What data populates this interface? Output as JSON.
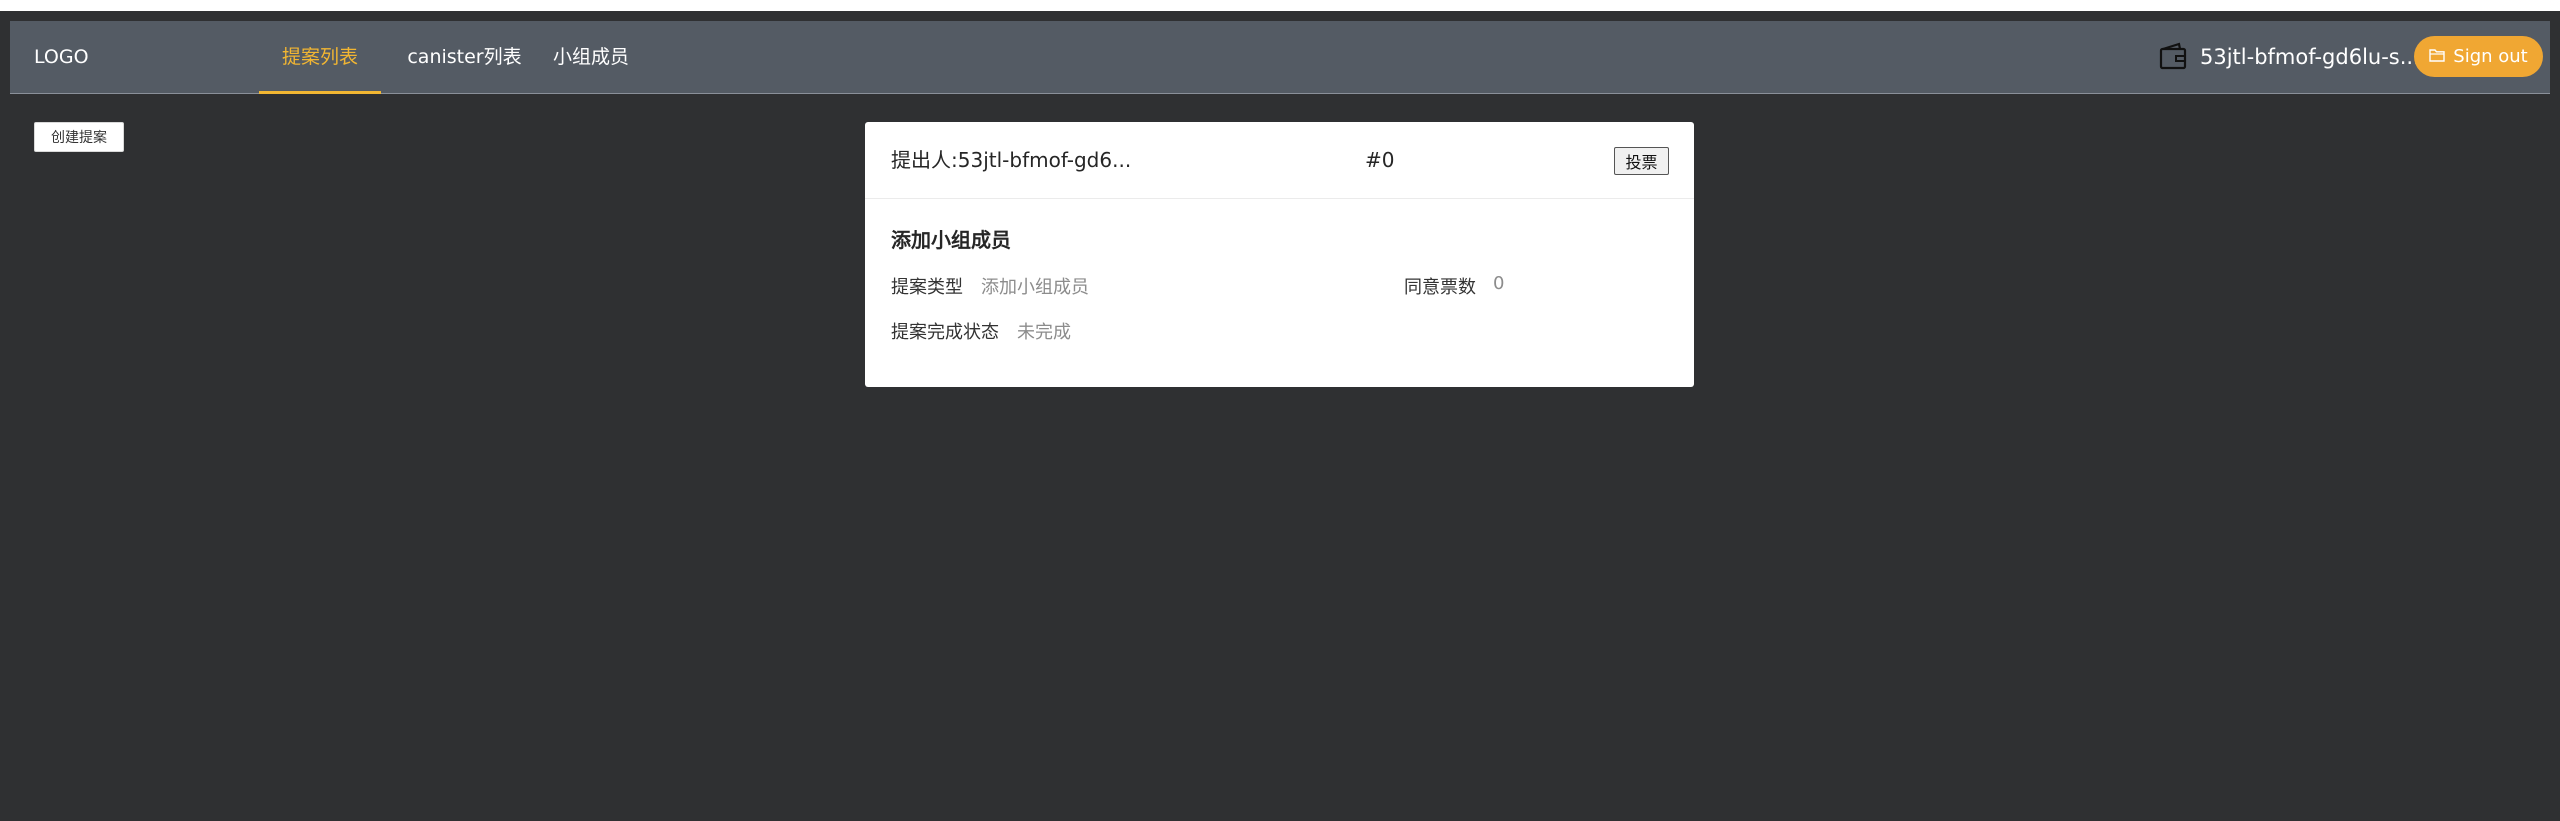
{
  "navbar": {
    "logo": "LOGO",
    "tabs": [
      {
        "label": "提案列表",
        "active": true
      },
      {
        "label": "canister列表",
        "active": false
      },
      {
        "label": "小组成员",
        "active": false
      }
    ],
    "wallet_icon": "wallet-icon",
    "wallet_address": "53jtl-bfmof-gd6lu-s...",
    "signout_label": "Sign out",
    "signout_icon": "folder-icon"
  },
  "toolbar": {
    "create_label": "创建提案"
  },
  "proposal": {
    "proposer_label": "提出人:",
    "proposer_value": "53jtl-bfmof-gd6...",
    "id": "#0",
    "vote_label": "投票",
    "title": "添加小组成员",
    "type_label": "提案类型",
    "type_value": "添加小组成员",
    "agree_label": "同意票数",
    "agree_value": "0",
    "status_label": "提案完成状态",
    "status_value": "未完成"
  },
  "colors": {
    "background": "#2f3032",
    "navbar": "#545b64",
    "accent": "#f2b632",
    "signout": "#f0a733"
  }
}
